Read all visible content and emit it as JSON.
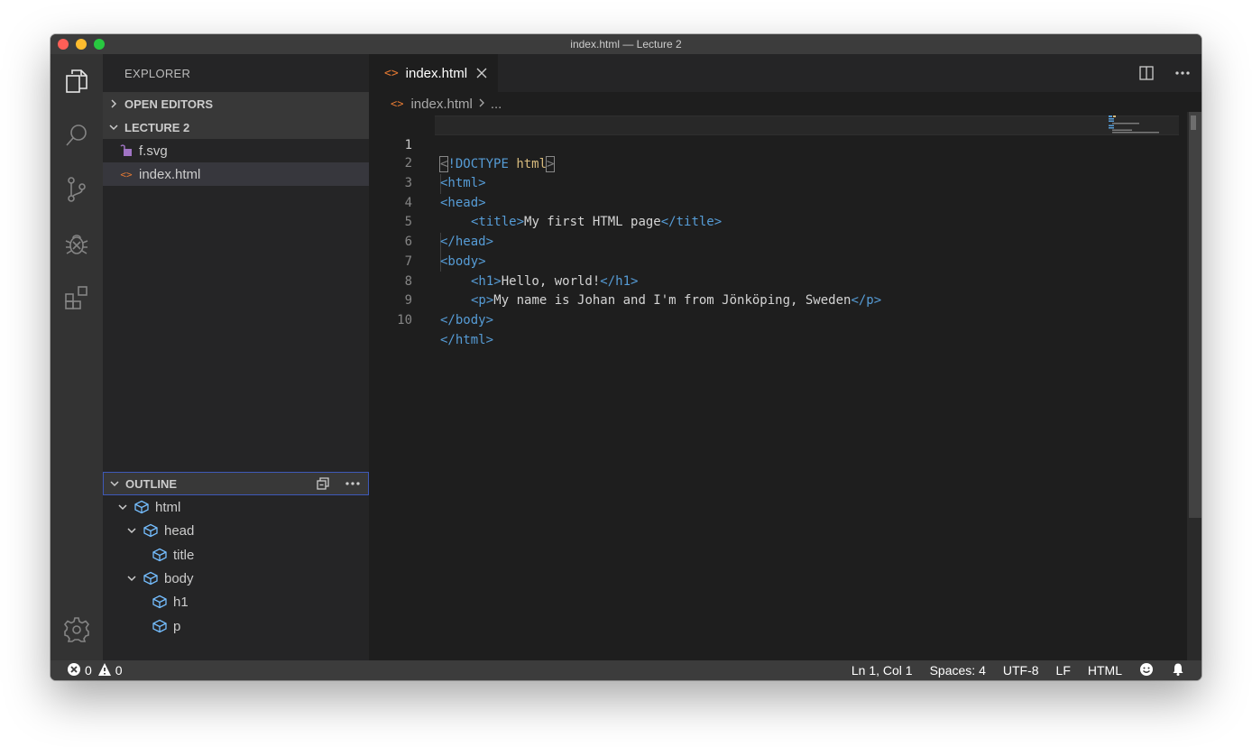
{
  "window": {
    "title": "index.html — Lecture 2"
  },
  "sidebar": {
    "title": "EXPLORER",
    "open_editors": "OPEN EDITORS",
    "folder": "LECTURE 2",
    "files": [
      {
        "name": "f.svg",
        "icon": "svg-file-icon"
      },
      {
        "name": "index.html",
        "icon": "html-file-icon"
      }
    ],
    "outline": {
      "title": "OUTLINE",
      "items": [
        "html",
        "head",
        "title",
        "body",
        "h1",
        "p"
      ]
    }
  },
  "editor": {
    "tab_label": "index.html",
    "tab_icon": "<>",
    "breadcrumb_file": "index.html",
    "breadcrumb_more": "...",
    "line_numbers": [
      "1",
      "2",
      "3",
      "4",
      "5",
      "6",
      "7",
      "8",
      "9",
      "10"
    ],
    "lines": {
      "l1": {
        "open": "<",
        "kw": "!DOCTYPE",
        "val": "html",
        "close": ">"
      },
      "l2": "<html>",
      "l3": "<head>",
      "l4": {
        "otag": "<title>",
        "text": "My first HTML page",
        "ctag": "</title>"
      },
      "l5": "</head>",
      "l6": "<body>",
      "l7": {
        "otag": "<h1>",
        "text": "Hello, world!",
        "ctag": "</h1>"
      },
      "l8": {
        "otag": "<p>",
        "text": "My name is Johan and I'm from Jönköping, Sweden",
        "ctag": "</p>"
      },
      "l9": "</body>",
      "l10": "</html>"
    }
  },
  "status": {
    "errors": "0",
    "warnings": "0",
    "position": "Ln 1, Col 1",
    "spaces": "Spaces: 4",
    "encoding": "UTF-8",
    "eol": "LF",
    "language": "HTML"
  },
  "colors": {
    "accent_blue": "#569cd6",
    "doctype_value": "#d7ba7d",
    "html_icon": "#e37933",
    "outline_cube": "#75beff",
    "svg_icon": "#a074c4"
  }
}
